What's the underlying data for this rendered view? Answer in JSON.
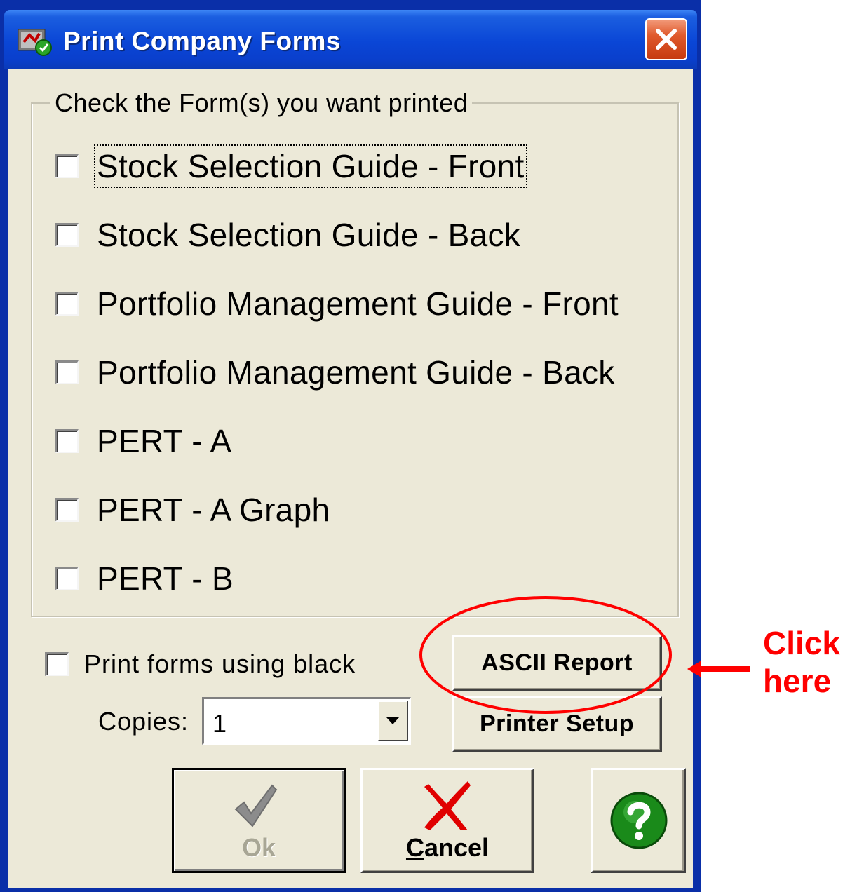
{
  "window": {
    "title": "Print Company Forms",
    "close_glyph": "✕"
  },
  "group": {
    "legend": "Check the Form(s) you want printed",
    "forms": [
      {
        "label": "Stock Selection Guide - Front",
        "checked": false
      },
      {
        "label": "Stock Selection Guide - Back",
        "checked": false
      },
      {
        "label": "Portfolio Management Guide - Front",
        "checked": false
      },
      {
        "label": "Portfolio Management Guide - Back",
        "checked": false
      },
      {
        "label": "PERT - A",
        "checked": false
      },
      {
        "label": "PERT - A Graph",
        "checked": false
      },
      {
        "label": "PERT - B",
        "checked": false
      }
    ]
  },
  "options": {
    "black_label": "Print forms using black",
    "black_checked": false,
    "copies_label": "Copies:",
    "copies_value": "1"
  },
  "buttons": {
    "ascii_report": "ASCII Report",
    "printer_setup": "Printer Setup",
    "ok": "Ok",
    "cancel": "Cancel"
  },
  "annotation": {
    "line1": "Click",
    "line2": "here",
    "color": "#ff0000"
  },
  "colors": {
    "titlebar": "#0a46d6",
    "dialog_bg": "#ece9d8",
    "ok_check": "#8c8c8c",
    "cancel_x": "#e00000",
    "help_green": "#1a8a1a"
  },
  "icons": [
    "app-icon",
    "close-icon",
    "chevron-down-icon",
    "check-icon",
    "x-icon",
    "help-icon",
    "arrow-left-icon"
  ]
}
